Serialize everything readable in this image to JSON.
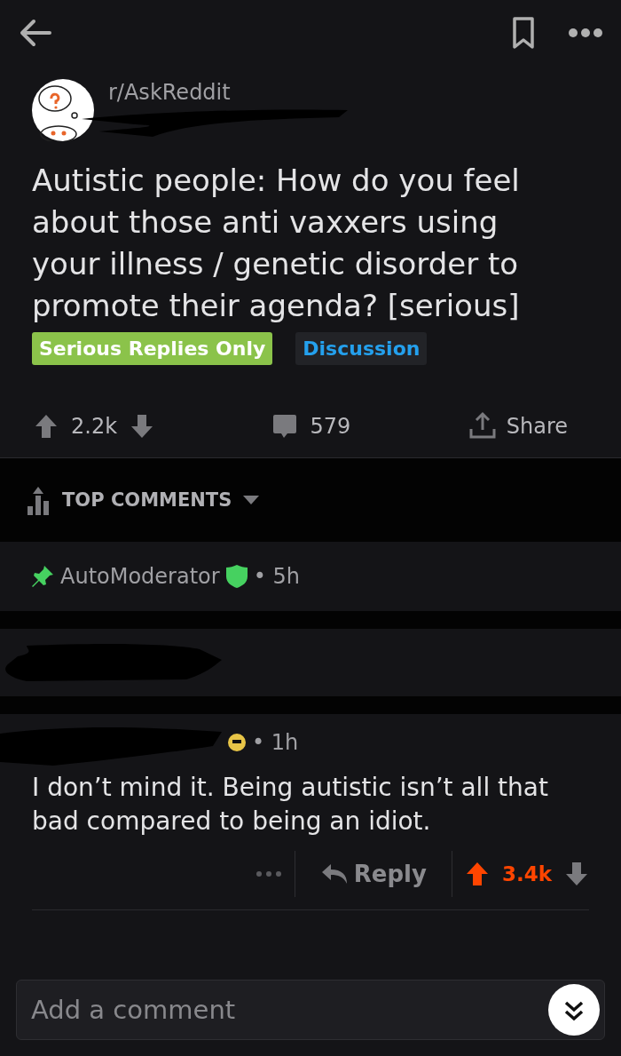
{
  "post": {
    "subreddit": "r/AskReddit",
    "title": "Autistic people: How do you feel about those anti vaxxers using your illness / genetic disorder to promote their agenda? [serious]",
    "flairs": [
      {
        "label": "Serious Replies Only",
        "color": "#8bc34a"
      },
      {
        "label": "Discussion",
        "color": "#24a0ed"
      }
    ],
    "score": "2.2k",
    "upvoted": false,
    "comments": "579",
    "share": "Share"
  },
  "sort": {
    "label": "TOP COMMENTS"
  },
  "comments": [
    {
      "kind": "pinned",
      "author": "AutoModerator",
      "time": "• 5h"
    },
    {
      "kind": "collapsed"
    },
    {
      "kind": "full",
      "time": "• 1h",
      "body": "I don’t mind it. Being autistic isn’t all that bad compared to being an idiot.",
      "reply": "Reply",
      "score": "3.4k",
      "upvoted": true
    }
  ],
  "composer": {
    "placeholder": "Add a comment"
  }
}
